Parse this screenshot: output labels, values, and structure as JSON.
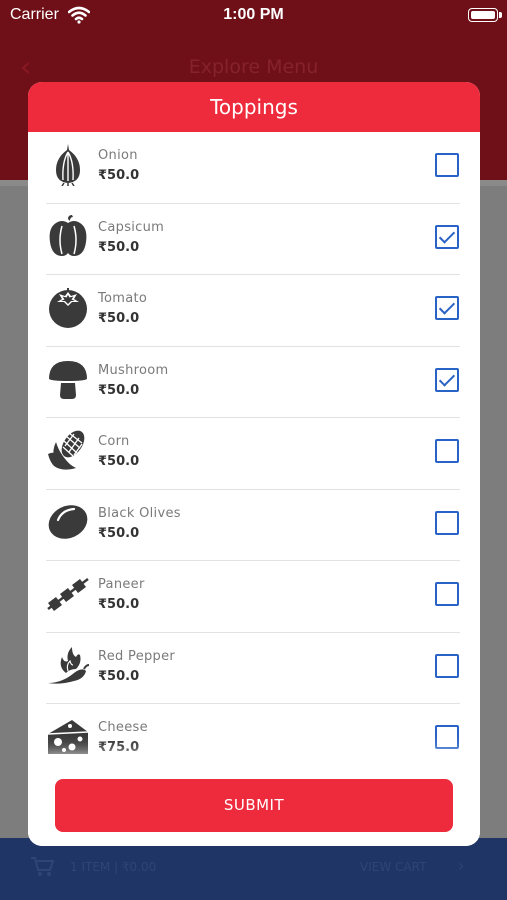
{
  "status_bar": {
    "carrier": "Carrier",
    "time": "1:00 PM"
  },
  "background": {
    "title": "Explore Menu",
    "cart_text": "1 ITEM | ₹0.00",
    "view_cart": "VIEW CART"
  },
  "modal": {
    "title": "Toppings",
    "submit_label": "SUBMIT"
  },
  "toppings": [
    {
      "name": "Onion",
      "price": "₹50.0",
      "checked": false,
      "icon": "onion-icon"
    },
    {
      "name": "Capsicum",
      "price": "₹50.0",
      "checked": true,
      "icon": "capsicum-icon"
    },
    {
      "name": "Tomato",
      "price": "₹50.0",
      "checked": true,
      "icon": "tomato-icon"
    },
    {
      "name": "Mushroom",
      "price": "₹50.0",
      "checked": true,
      "icon": "mushroom-icon"
    },
    {
      "name": "Corn",
      "price": "₹50.0",
      "checked": false,
      "icon": "corn-icon"
    },
    {
      "name": "Black Olives",
      "price": "₹50.0",
      "checked": false,
      "icon": "olive-icon"
    },
    {
      "name": "Paneer",
      "price": "₹50.0",
      "checked": false,
      "icon": "paneer-icon"
    },
    {
      "name": "Red Pepper",
      "price": "₹50.0",
      "checked": false,
      "icon": "red-pepper-icon"
    },
    {
      "name": "Cheese",
      "price": "₹75.0",
      "checked": false,
      "icon": "cheese-icon"
    }
  ],
  "colors": {
    "accent": "#ee2b3c",
    "checkbox": "#2a63c6",
    "icon": "#3a3a3a"
  }
}
